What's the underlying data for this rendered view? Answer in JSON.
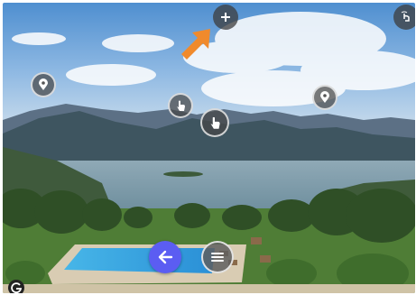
{
  "viewer": {
    "scene": "panorama-lake-view",
    "hotspots": [
      {
        "name": "add-hotspot-button",
        "icon": "plus-icon"
      },
      {
        "name": "panorama-toggle-button",
        "icon": "gyro-hand-icon"
      },
      {
        "name": "location-marker-left",
        "icon": "map-pin-icon"
      },
      {
        "name": "location-marker-right",
        "icon": "map-pin-icon"
      },
      {
        "name": "interaction-hotspot-1",
        "icon": "tap-hand-icon"
      },
      {
        "name": "interaction-hotspot-2",
        "icon": "tap-hand-icon"
      }
    ],
    "annotation_arrow": {
      "color": "#f08a2c",
      "points_to": "add-hotspot-button"
    }
  },
  "controls": {
    "back_button": {
      "icon": "arrow-left-icon",
      "color": "#5b5df2"
    },
    "menu_button": {
      "icon": "hamburger-menu-icon"
    }
  },
  "brand": {
    "icon": "g-logo-icon"
  }
}
